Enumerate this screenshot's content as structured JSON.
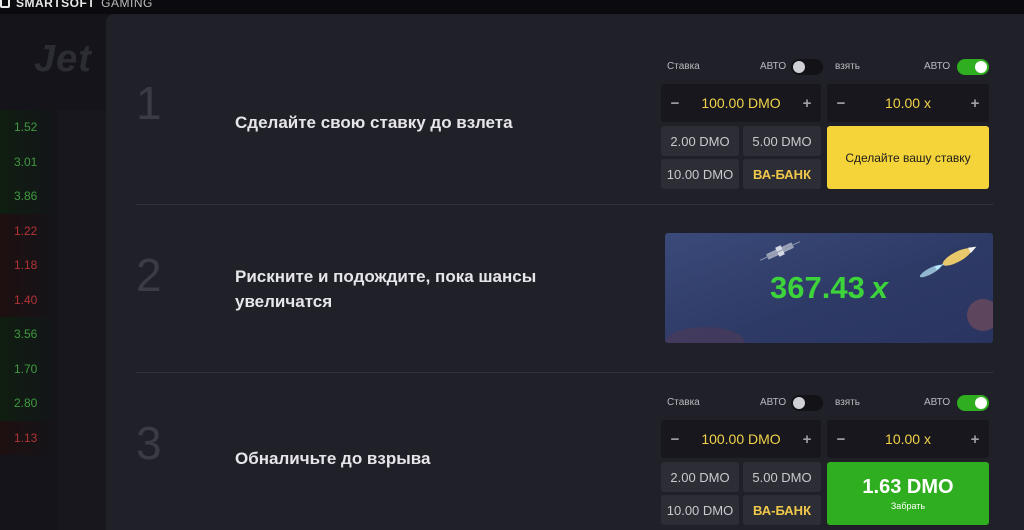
{
  "brand": {
    "name_bold": "SMARTSOFT",
    "name_light": "GAMING",
    "logo": "Jet"
  },
  "history": [
    {
      "value": "1.52",
      "tone": "g"
    },
    {
      "value": "3.01",
      "tone": "g"
    },
    {
      "value": "3.86",
      "tone": "g"
    },
    {
      "value": "1.22",
      "tone": "r"
    },
    {
      "value": "1.18",
      "tone": "r"
    },
    {
      "value": "1.40",
      "tone": "r"
    },
    {
      "value": "3.56",
      "tone": "g"
    },
    {
      "value": "1.70",
      "tone": "g"
    },
    {
      "value": "2.80",
      "tone": "g"
    },
    {
      "value": "1.13",
      "tone": "r"
    }
  ],
  "steps": [
    {
      "number": "1",
      "text": "Сделайте свою ставку до взлета"
    },
    {
      "number": "2",
      "text_line1": "Рискните и подождите, пока шансы",
      "text_line2": "увеличатся"
    },
    {
      "number": "3",
      "text": "Обналичьте до взрыва"
    }
  ],
  "bet_widget": {
    "bet_label": "Ставка",
    "take_label": "взять",
    "auto_label": "АВТО",
    "bet_auto_on": false,
    "take_auto_on": true,
    "minus": "−",
    "plus": "+",
    "bet_amount": "100.00 DMO",
    "take_multiplier": "10.00 x",
    "quick_bets": [
      "2.00 DMO",
      "5.00 DMO",
      "10.00 DMO"
    ],
    "all_in": "ВА-БАНК",
    "place_bet": "Сделайте вашу ставку",
    "cashout_amount": "1.63 DMO",
    "cashout_label": "Забрать"
  },
  "preview": {
    "multiplier": "367.43",
    "suffix": "x"
  },
  "colors": {
    "accent_yellow": "#f5d43a",
    "cashout_green": "#2fae1f",
    "multiplier_green": "#3cd43a"
  }
}
